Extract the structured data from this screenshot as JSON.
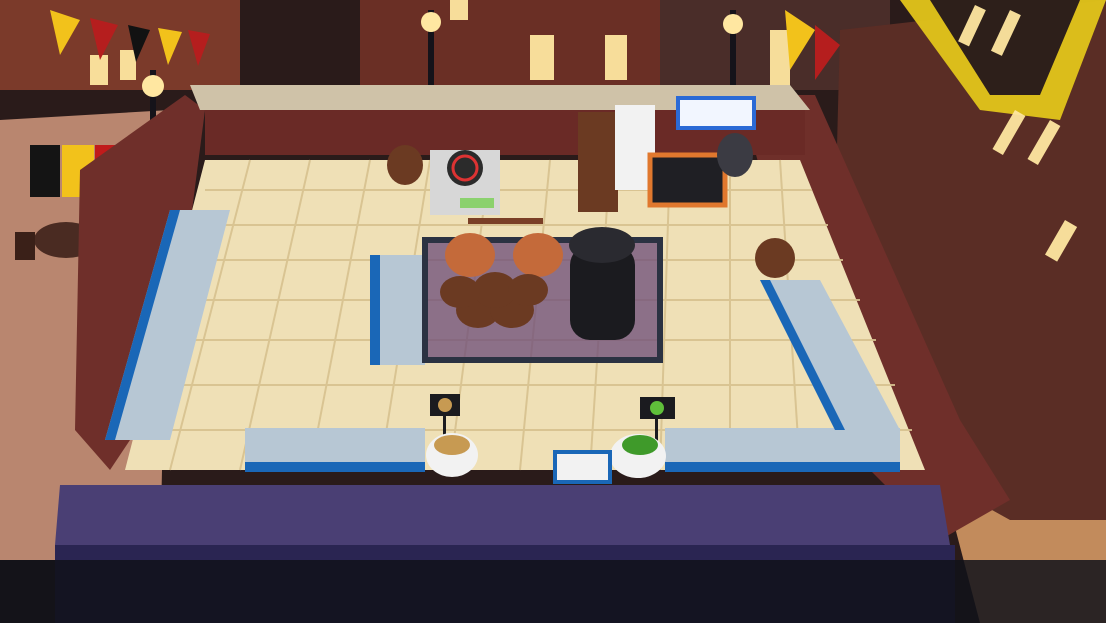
{
  "scene": {
    "title": "",
    "description_visible_text": []
  },
  "palette": {
    "floor_light": "#efe0b6",
    "floor_grid": "#d7c18f",
    "wall_top": "#cfc2a8",
    "wall_side": "#6f2f2a",
    "counter_blue": "#1a67b7",
    "counter_top": "#b7c7d4",
    "front_wall": "#2a2552",
    "front_wall_top": "#4a3f74",
    "copper": "#c46a3a",
    "barrel_wood": "#6b3a22",
    "tank_black": "#1b1b1f",
    "street_orange": "#c78b4f",
    "building_brown": "#6c3b2c",
    "building_dark": "#3b2620",
    "window_glow": "#ffe7a1",
    "flag_yellow": "#f2c21b",
    "flag_red": "#b51e1e",
    "flag_black": "#121212"
  },
  "icons": {
    "potato_sign": "potato-icon",
    "hops_sign": "hops-icon",
    "wheat_sign": "wheat-icon",
    "stove": "stove-icon",
    "tv_screen": "screen-icon"
  }
}
